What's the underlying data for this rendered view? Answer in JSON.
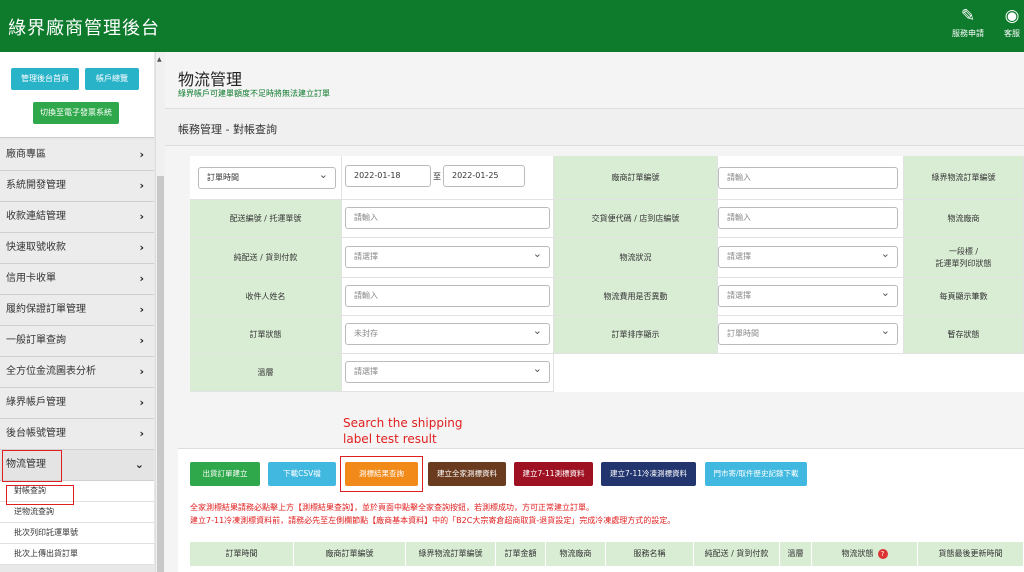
{
  "header": {
    "title": "綠界廠商管理後台",
    "service_apply": "服務申請",
    "support": "客服"
  },
  "sidebar": {
    "btn_home": "管理後台首頁",
    "btn_account": "帳戶總覽",
    "btn_switch": "切換至電子發票系統",
    "items": [
      {
        "label": "廠商專區"
      },
      {
        "label": "系統開發管理"
      },
      {
        "label": "收款連結管理"
      },
      {
        "label": "快速取號收款"
      },
      {
        "label": "信用卡收單"
      },
      {
        "label": "履約保證訂單管理"
      },
      {
        "label": "一般訂單查詢"
      },
      {
        "label": "全方位金流圖表分析"
      },
      {
        "label": "綠界帳戶管理"
      },
      {
        "label": "後台帳號管理"
      },
      {
        "label": "物流管理"
      }
    ],
    "subitems": [
      {
        "label": "對帳查詢"
      },
      {
        "label": "逆物流查詢"
      },
      {
        "label": "批次列印託運單號"
      },
      {
        "label": "批次上傳出貨訂單"
      }
    ]
  },
  "page": {
    "title": "物流管理",
    "subtitle": "綠界帳戶可建單額度不足時將無法建立訂單",
    "section": "帳務管理 - 對帳查詢"
  },
  "form": {
    "date_type": "訂單時間",
    "date_from": "2022-01-18",
    "date_sep": "至",
    "date_to": "2022-01-25",
    "placeholder": "請輸入",
    "select_placeholder": "請選擇",
    "labels": {
      "merchant_order_no": "廠商訂單編號",
      "ecpay_logistics_no": "綠界物流訂單編號",
      "delivery_no": "配送編號 / 托運單號",
      "cvs_code": "交貨便代碼 / 店到店編號",
      "logistics_vendor": "物流廠商",
      "cod": "純配送 / 貨到付款",
      "logistics_status": "物流狀況",
      "label_print_status_l1": "一段標 /",
      "label_print_status_l2": "託運單列印狀態",
      "receiver_name": "收件人姓名",
      "fee_changed": "物流費用是否異動",
      "page_size": "每頁顯示筆數",
      "order_status": "訂單狀態",
      "order_sort": "訂單排序顯示",
      "temp_status": "暫存狀態",
      "temperature": "溫層"
    },
    "order_status_value": "未封存",
    "order_sort_value": "訂單時間"
  },
  "annotation": {
    "line1": "Search the shipping",
    "line2": "label test result"
  },
  "actions": {
    "create_order": "出貨訂單建立",
    "download_csv": "下載CSV檔",
    "test_result": "測標結果查詢",
    "family_test": "建立全家測標資料",
    "seven_test": "建立7-11測標資料",
    "seven_cold_test": "建立7-11冷凍測標資料",
    "store_history": "門市寄/取件歷史記錄下載"
  },
  "notes": {
    "line1": "全家測標結果請務必點擊上方【測標結果查詢】，並於頁面中點擊全家查詢按鈕，若測標成功，方可正常建立訂單。",
    "line2": "建立7-11冷凍測標資料前，請務必先至左側欄節點【廠商基本資料】中的「B2C大宗寄倉超商取貨-退貨設定」完成冷凍處理方式的設定。"
  },
  "table": {
    "headers": [
      "訂單時間",
      "廠商訂單編號",
      "綠界物流訂單編號",
      "訂單金額",
      "物流廠商",
      "服務名稱",
      "純配送 / 貨到付款",
      "溫層",
      "物流狀態",
      "貨態最後更新時間"
    ]
  },
  "colors": {
    "brand_green": "#0d7a2c",
    "label_bg": "#d9ecd4",
    "teal": "#29b3c9",
    "green": "#2ea84a",
    "orange": "#f28a1a",
    "brown": "#6b3b1f",
    "maroon": "#9e1122",
    "navy": "#22356e",
    "light_blue": "#40b8e0",
    "alert_red": "#e02020"
  }
}
